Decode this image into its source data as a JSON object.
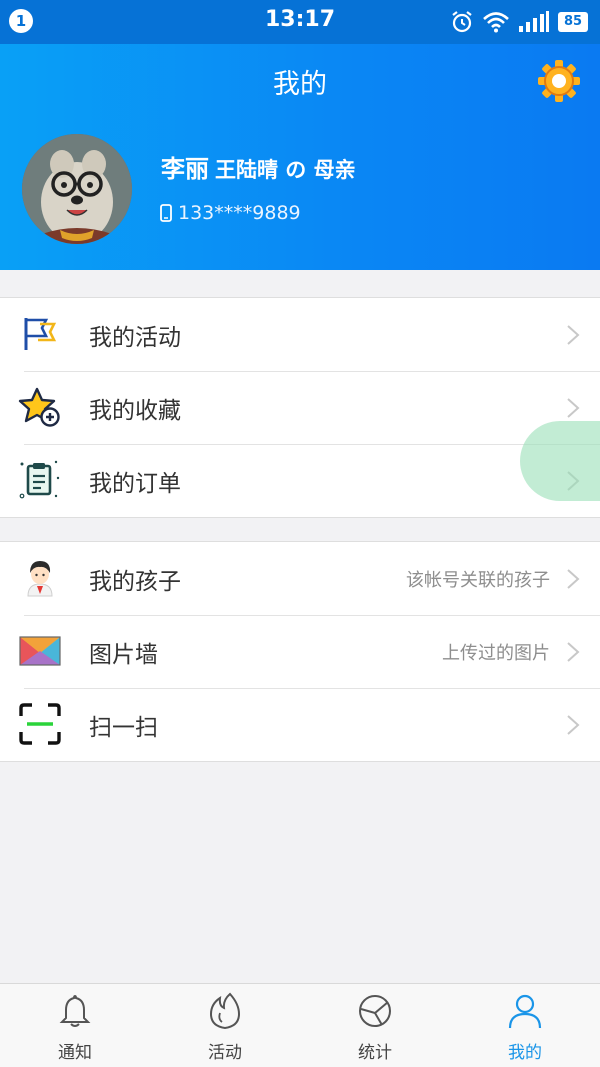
{
  "status_bar": {
    "notification_count": "1",
    "time": "13:17",
    "battery": "85"
  },
  "header": {
    "title": "我的",
    "settings_icon": "gear-icon",
    "user": {
      "name": "李丽",
      "relation": "王陆晴 の 母亲",
      "phone": "133****9889"
    }
  },
  "menu_group_1": [
    {
      "label": "我的活动",
      "icon": "flag-icon"
    },
    {
      "label": "我的收藏",
      "icon": "star-plus-icon"
    },
    {
      "label": "我的订单",
      "icon": "clipboard-icon"
    }
  ],
  "menu_group_2": [
    {
      "label": "我的孩子",
      "hint": "该帐号关联的孩子",
      "icon": "child-icon"
    },
    {
      "label": "图片墙",
      "hint": "上传过的图片",
      "icon": "envelope-picture-icon"
    },
    {
      "label": "扫一扫",
      "hint": "",
      "icon": "scan-icon"
    }
  ],
  "tabbar": [
    {
      "label": "通知",
      "icon": "bell-icon",
      "active": false
    },
    {
      "label": "活动",
      "icon": "flame-icon",
      "active": false
    },
    {
      "label": "统计",
      "icon": "pie-chart-icon",
      "active": false
    },
    {
      "label": "我的",
      "icon": "person-icon",
      "active": true
    }
  ],
  "colors": {
    "status_bar": "#0672d6",
    "header_start": "#09a0f6",
    "header_end": "#0a7af2",
    "active_tab": "#1a95e8"
  }
}
